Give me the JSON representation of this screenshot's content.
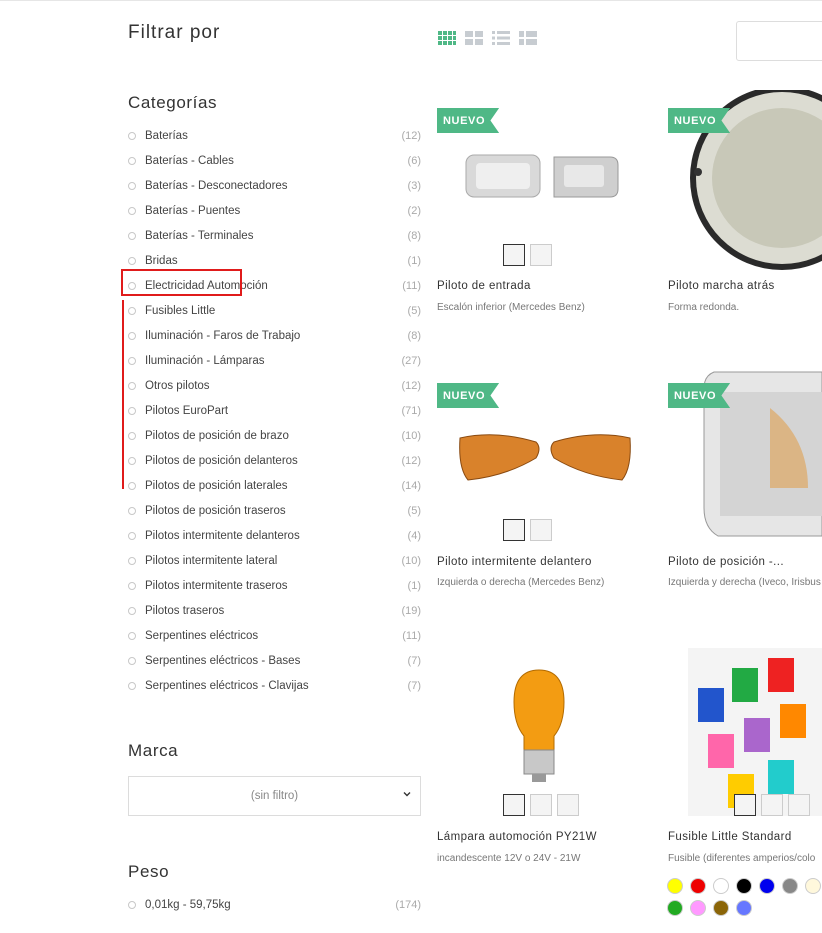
{
  "filters": {
    "title": "Filtrar por",
    "categories_title": "Categorías",
    "categories": [
      {
        "name": "Baterías",
        "count": "(12)"
      },
      {
        "name": "Baterías - Cables",
        "count": "(6)"
      },
      {
        "name": "Baterías - Desconectadores",
        "count": "(3)"
      },
      {
        "name": "Baterías - Puentes",
        "count": "(2)"
      },
      {
        "name": "Baterías - Terminales",
        "count": "(8)"
      },
      {
        "name": "Bridas",
        "count": "(1)"
      },
      {
        "name": "Electricidad Automoción",
        "count": "(11)"
      },
      {
        "name": "Fusibles Little",
        "count": "(5)"
      },
      {
        "name": "Iluminación - Faros de Trabajo",
        "count": "(8)"
      },
      {
        "name": "Iluminación - Lámparas",
        "count": "(27)"
      },
      {
        "name": "Otros pilotos",
        "count": "(12)"
      },
      {
        "name": "Pilotos EuroPart",
        "count": "(71)"
      },
      {
        "name": "Pilotos de posición de brazo",
        "count": "(10)"
      },
      {
        "name": "Pilotos de posición delanteros",
        "count": "(12)"
      },
      {
        "name": "Pilotos de posición laterales",
        "count": "(14)"
      },
      {
        "name": "Pilotos de posición traseros",
        "count": "(5)"
      },
      {
        "name": "Pilotos intermitente delanteros",
        "count": "(4)"
      },
      {
        "name": "Pilotos intermitente lateral",
        "count": "(10)"
      },
      {
        "name": "Pilotos intermitente traseros",
        "count": "(1)"
      },
      {
        "name": "Pilotos traseros",
        "count": "(19)"
      },
      {
        "name": "Serpentines eléctricos",
        "count": "(11)"
      },
      {
        "name": "Serpentines eléctricos - Bases",
        "count": "(7)"
      },
      {
        "name": "Serpentines eléctricos - Clavijas",
        "count": "(7)"
      }
    ],
    "brand_title": "Marca",
    "brand_select": "(sin filtro)",
    "weight_title": "Peso",
    "weight_option": {
      "name": "0,01kg - 59,75kg",
      "count": "(174)"
    }
  },
  "view_icons": [
    "grid-4-icon",
    "grid-2-icon",
    "list-icon",
    "list-detail-icon"
  ],
  "accent_color": "#4fb886",
  "highlight_color": "#e01b1b",
  "products": [
    {
      "badge": "NUEVO",
      "title": "Piloto de entrada",
      "subtitle": "Escalón inferior (Mercedes Benz)"
    },
    {
      "badge": "NUEVO",
      "title": "Piloto marcha atrás",
      "subtitle": "Forma redonda."
    },
    {
      "badge": "NUEVO",
      "title": "Piloto intermitente delantero",
      "subtitle": "Izquierda o derecha (Mercedes Benz)"
    },
    {
      "badge": "NUEVO",
      "title": "Piloto de posición -...",
      "subtitle": "Izquierda y derecha (Iveco, Irisbus"
    },
    {
      "badge": "",
      "title": "Lámpara automoción PY21W",
      "subtitle": "incandescente 12V o 24V - 21W"
    },
    {
      "badge": "",
      "title": "Fusible Little Standard",
      "subtitle": "Fusible (diferentes amperios/colo"
    }
  ],
  "fuse_colors": [
    "#ffff00",
    "#ee0000",
    "#ffffff",
    "#000000",
    "#0000ee",
    "#888888",
    "#fff8dc",
    "#22aa22",
    "#ff99ff",
    "#8b6508",
    "#6677ff"
  ]
}
